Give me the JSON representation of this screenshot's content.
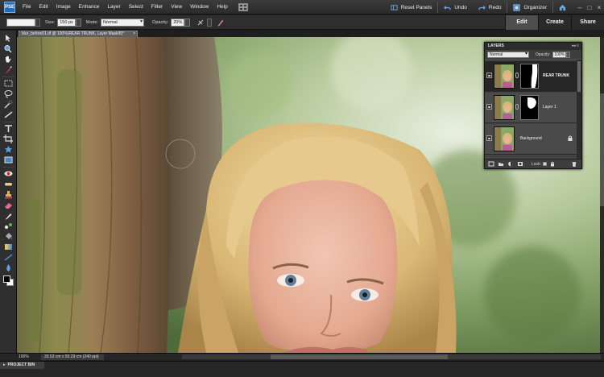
{
  "menubar": {
    "logo": "PSE",
    "items": [
      "File",
      "Edit",
      "Image",
      "Enhance",
      "Layer",
      "Select",
      "Filter",
      "View",
      "Window",
      "Help"
    ],
    "right": {
      "reset_panels": "Reset Panels",
      "undo": "Undo",
      "redo": "Redo",
      "organizer": "Organizer"
    }
  },
  "optionsbar": {
    "size_label": "Size:",
    "size_value": "150 px",
    "mode_label": "Mode:",
    "mode_value": "Normal",
    "opacity_label": "Opacity:",
    "opacity_value": "20%"
  },
  "mode_tabs": [
    "Edit",
    "Create",
    "Share"
  ],
  "document_tab": {
    "title": "blur_before01.tif @ 100%(REAR TRUNK, Layer Mask/8)*",
    "close": "×"
  },
  "status": {
    "zoom": "100%",
    "doc_info": "33.53 cm x 50.29 cm (240 ppi)"
  },
  "project_bin": {
    "label": "PROJECT BIN"
  },
  "layers_panel": {
    "title": "LAYERS",
    "blend_mode": "Normal",
    "opacity_label": "Opacity:",
    "opacity_value": "100%",
    "lock_label": "Lock:",
    "layers": [
      {
        "name": "REAR TRUNK",
        "selected": true
      },
      {
        "name": "Layer 1",
        "selected": false
      },
      {
        "name": "Background",
        "selected": false
      }
    ]
  },
  "colors": {
    "accent": "#1f6fb8",
    "panel": "#4d4d4d",
    "chrome": "#2e2e2e"
  },
  "icons": [
    "move-icon",
    "zoom-icon",
    "hand-icon",
    "eyedropper-icon",
    "marquee-icon",
    "lasso-icon",
    "quick-selection-icon",
    "straighten-icon",
    "type-icon",
    "crop-icon",
    "cookie-cutter-icon",
    "red-eye-icon",
    "spot-healing-icon",
    "clone-stamp-icon",
    "eraser-icon",
    "brush-icon",
    "smart-brush-icon",
    "paint-bucket-icon",
    "gradient-icon",
    "custom-shape-icon",
    "blur-icon",
    "sponge-icon",
    "undo-icon",
    "redo-icon",
    "home-icon"
  ]
}
